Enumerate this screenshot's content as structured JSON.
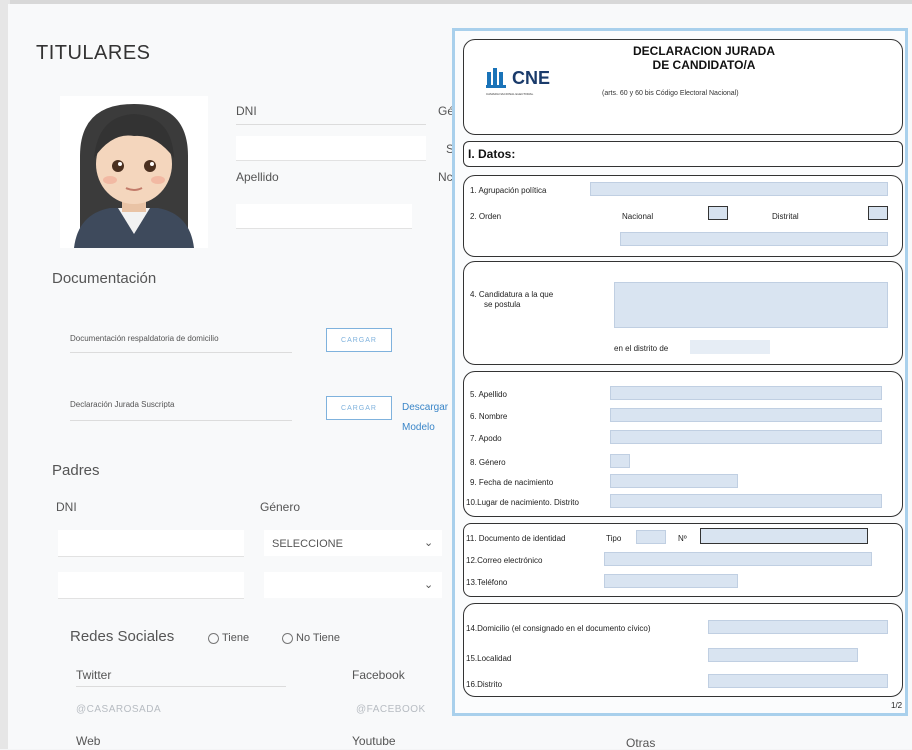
{
  "page": {
    "title": "TITULARES",
    "avatar_icon": "woman-emoji-icon"
  },
  "person": {
    "dni_label": "DNI",
    "genero_label_partial": "Gé",
    "s_partial": "S",
    "apellido_label": "Apellido",
    "nombre_partial": "Nc"
  },
  "documentacion": {
    "title": "Documentación",
    "items": [
      {
        "label": "Documentación respaldatoria de domicilio",
        "button": "CARGAR"
      },
      {
        "label": "Declaración Jurada Suscripta",
        "button": "CARGAR"
      }
    ],
    "download_link_1": "Descargar",
    "download_link_2": "Modelo"
  },
  "padres": {
    "title": "Padres",
    "dni_label": "DNI",
    "genero_label": "Género",
    "genero_select_value": "SELECCIONE"
  },
  "redes": {
    "title": "Redes Sociales",
    "opt_tiene": "Tiene",
    "opt_no_tiene": "No Tiene",
    "twitter_label": "Twitter",
    "twitter_placeholder": "@CASAROSADA",
    "facebook_label": "Facebook",
    "facebook_placeholder": "@FACEBOOK",
    "web_label": "Web",
    "youtube_label": "Youtube",
    "otras_label": "Otras"
  },
  "cne_form": {
    "logo_text": "CNE",
    "logo_sub": "CAMARA NACIONAL ELECTORAL",
    "title_line1": "DECLARACION JURADA",
    "title_line2": "DE CANDIDATO/A",
    "subtitle": "(arts. 60 y 60 bis Código Electoral Nacional)",
    "section": "I. Datos:",
    "f1": "1. Agrupación política",
    "f2": "2. Orden",
    "nacional": "Nacional",
    "distrital": "Distrital",
    "f4_line1": "4. Candidatura a la que",
    "f4_line2": "se postula",
    "en_distrito": "en el distrito de",
    "f5": "5. Apellido",
    "f6": "6. Nombre",
    "f7": "7. Apodo",
    "f8": "8. Género",
    "f9": "9. Fecha de nacimiento",
    "f10": "10.Lugar de nacimiento. Distrito",
    "f11": "11. Documento de identidad",
    "tipo": "Tipo",
    "numero": "Nº",
    "f12": "12.Correo electrónico",
    "f13": "13.Teléfono",
    "f14": "14.Domicilio (el consignado en el documento cívico)",
    "f15": "15.Localidad",
    "f16": "16.Distrito",
    "page": "1/2"
  },
  "colors": {
    "accent": "#3a86c8",
    "form_border": "#a9d0ec",
    "form_field": "#d9e4f1"
  }
}
